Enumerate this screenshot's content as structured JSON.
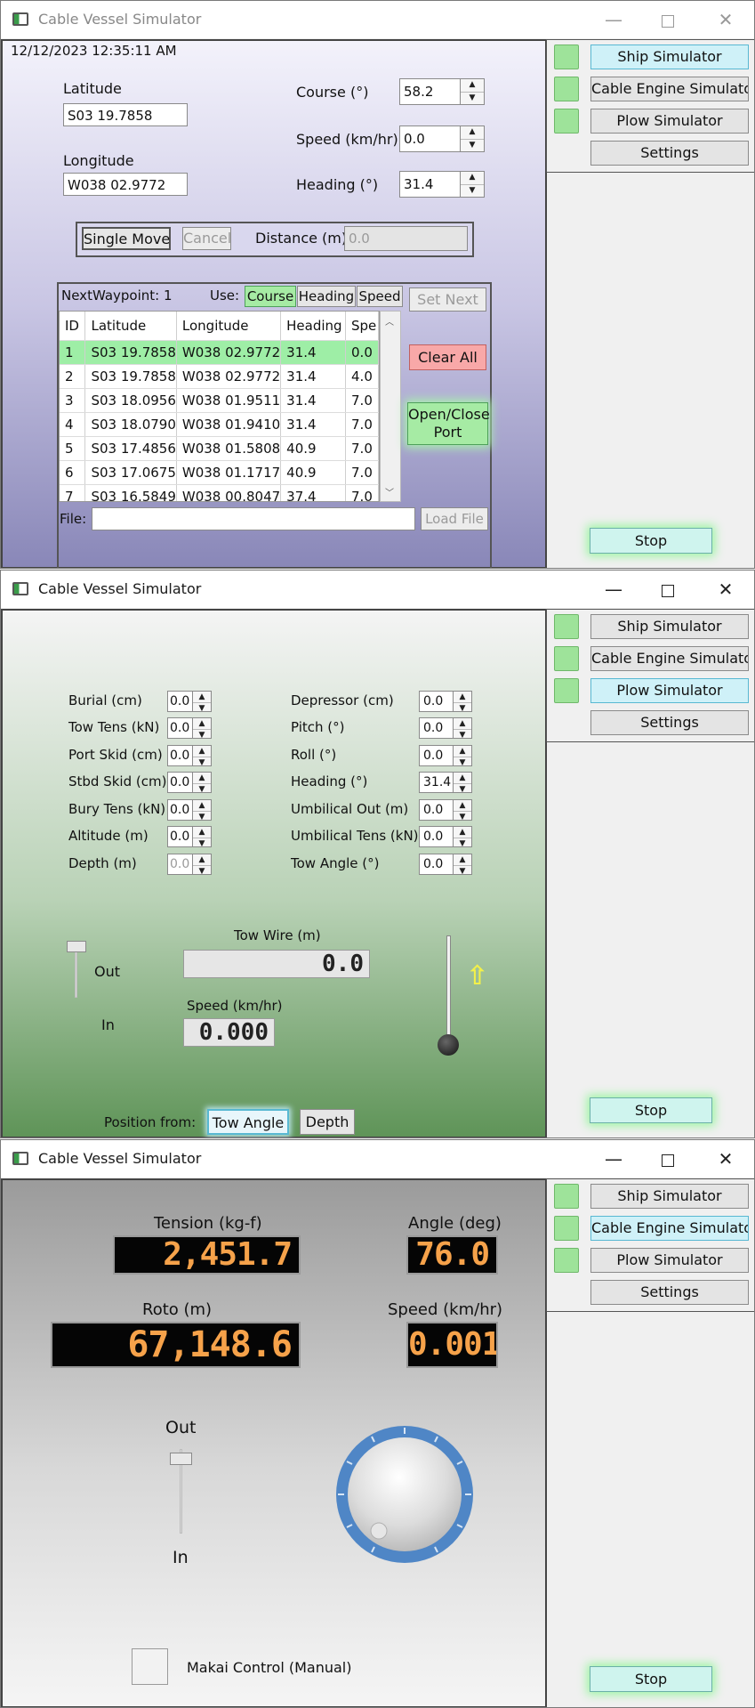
{
  "app": {
    "title": "Cable Vessel Simulator"
  },
  "nav": {
    "ship": "Ship Simulator",
    "cable": "Cable Engine Simulator",
    "plow": "Plow Simulator",
    "settings": "Settings",
    "stop": "Stop"
  },
  "ship": {
    "timestamp": "12/12/2023 12:35:11 AM",
    "latitude_label": "Latitude",
    "latitude": "S03 19.7858",
    "longitude_label": "Longitude",
    "longitude": "W038 02.9772",
    "course_label": "Course (°)",
    "course": "58.2",
    "speed_label": "Speed (km/hr)",
    "speed": "0.0",
    "heading_label": "Heading (°)",
    "heading": "31.4",
    "single_move": "Single Move",
    "cancel": "Cancel",
    "distance_label": "Distance (m)",
    "distance_placeholder": "0.0",
    "next_waypoint": "NextWaypoint: 1",
    "use_label": "Use:",
    "use_course": "Course",
    "use_heading": "Heading",
    "use_speed": "Speed",
    "set_next": "Set Next",
    "clear_all": "Clear All",
    "open_close_1": "Open/Close",
    "open_close_2": "Port",
    "file_label": "File:",
    "load_file": "Load File",
    "columns": [
      "ID",
      "Latitude",
      "Longitude",
      "Heading",
      "Spe"
    ],
    "waypoints": [
      [
        "1",
        "S03 19.7858",
        "W038 02.9772",
        "31.4",
        "0.0"
      ],
      [
        "2",
        "S03 19.7858",
        "W038 02.9772",
        "31.4",
        "4.0"
      ],
      [
        "3",
        "S03 18.0956",
        "W038 01.9511",
        "31.4",
        "7.0"
      ],
      [
        "4",
        "S03 18.0790",
        "W038 01.9410",
        "31.4",
        "7.0"
      ],
      [
        "5",
        "S03 17.4856",
        "W038 01.5808",
        "40.9",
        "7.0"
      ],
      [
        "6",
        "S03 17.0675",
        "W038 01.1717",
        "40.9",
        "7.0"
      ],
      [
        "7",
        "S03 16.5849",
        "W038 00.8047",
        "37.4",
        "7.0"
      ]
    ]
  },
  "plow": {
    "burial_label": "Burial (cm)",
    "burial": "0.0",
    "towtens_label": "Tow Tens (kN)",
    "towtens": "0.0",
    "portskid_label": "Port Skid (cm)",
    "portskid": "0.0",
    "stbdskid_label": "Stbd Skid (cm)",
    "stbdskid": "0.0",
    "burytens_label": "Bury Tens (kN)",
    "burytens": "0.0",
    "altitude_label": "Altitude (m)",
    "altitude": "0.0",
    "depth_label": "Depth (m)",
    "depth": "0.0",
    "depressor_label": "Depressor (cm)",
    "depressor": "0.0",
    "pitch_label": "Pitch (°)",
    "pitch": "0.0",
    "roll_label": "Roll (°)",
    "roll": "0.0",
    "heading_label": "Heading (°)",
    "heading": "31.4",
    "umbout_label": "Umbilical Out (m)",
    "umbout": "0.0",
    "umbtens_label": "Umbilical Tens (kN)",
    "umbtens": "0.0",
    "towangle_label": "Tow Angle (°)",
    "towangle": "0.0",
    "out_label": "Out",
    "in_label": "In",
    "towwire_label": "Tow Wire (m)",
    "towwire": "0.0",
    "speed_label": "Speed (km/hr)",
    "speed": "0.000",
    "position_label": "Position from:",
    "pos_towangle": "Tow Angle",
    "pos_depth": "Depth"
  },
  "cable": {
    "tension_label": "Tension (kg-f)",
    "tension": "2,451.7",
    "angle_label": "Angle (deg)",
    "angle": "76.0",
    "roto_label": "Roto (m)",
    "roto": "67,148.6",
    "speed_label": "Speed (km/hr)",
    "speed": "0.001",
    "out_label": "Out",
    "in_label": "In",
    "makai_label": "Makai Control (Manual)"
  }
}
